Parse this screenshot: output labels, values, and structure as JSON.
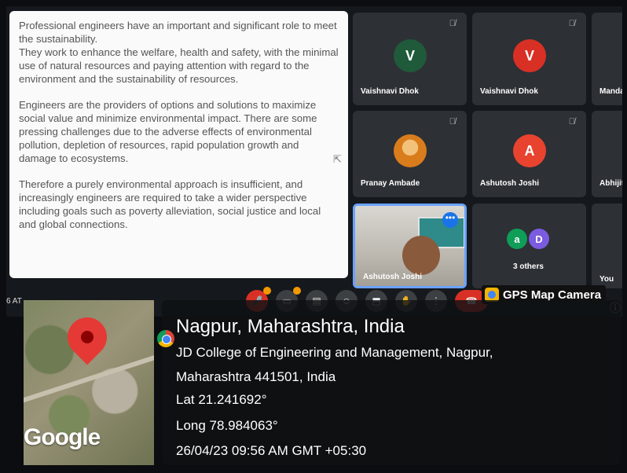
{
  "slide": {
    "paragraphs": [
      "Professional engineers have an important and significant role to meet the sustainability.\nThey work to enhance the welfare, health and safety, with the minimal use of natural resources and paying attention with regard to the environment and the sustainability of resources.",
      "Engineers are the providers of options and solutions to maximize social value and minimize environmental impact. There are some pressing challenges due to the adverse effects of environmental pollution, depletion of resources, rapid population growth and damage to ecosystems.",
      " Therefore a purely environmental approach is insufficient, and increasingly engineers are required to take a wider perspective including goals such as poverty alleviation, social justice and local and global connections."
    ]
  },
  "participants": [
    {
      "name": "Vaishnavi Dhok",
      "initial": "V",
      "color": "#1f5a3a"
    },
    {
      "name": "Vaishnavi Dhok",
      "initial": "V",
      "color": "#d93025"
    },
    {
      "name": "Manda",
      "initial": "",
      "color": "#2d3035"
    },
    {
      "name": "Pranay Ambade",
      "initial": "",
      "color": "#e08a2a"
    },
    {
      "name": "Ashutosh Joshi",
      "initial": "A",
      "color": "#e8432f"
    },
    {
      "name": "Abhijit",
      "initial": "",
      "color": "#2d3035"
    },
    {
      "name": "Ashutosh Joshi",
      "initial": "",
      "color": "#cfcfcf"
    },
    {
      "name": "3 others",
      "initials": [
        "a",
        "D"
      ],
      "colors": [
        "#0f9d58",
        "#7b5be0"
      ]
    },
    {
      "name": "You",
      "initial": "",
      "color": "#2d3035"
    }
  ],
  "meeting_left_text": "6 AT",
  "gps_label": "GPS Map Camera",
  "map": {
    "brand": "Google"
  },
  "location": {
    "city": "Nagpur, Maharashtra, India",
    "address1": "JD College of Engineering and Management, Nagpur,",
    "address2": "Maharashtra 441501, India",
    "lat": "Lat 21.241692°",
    "long": "Long 78.984063°",
    "datetime": "26/04/23 09:56 AM GMT +05:30"
  }
}
